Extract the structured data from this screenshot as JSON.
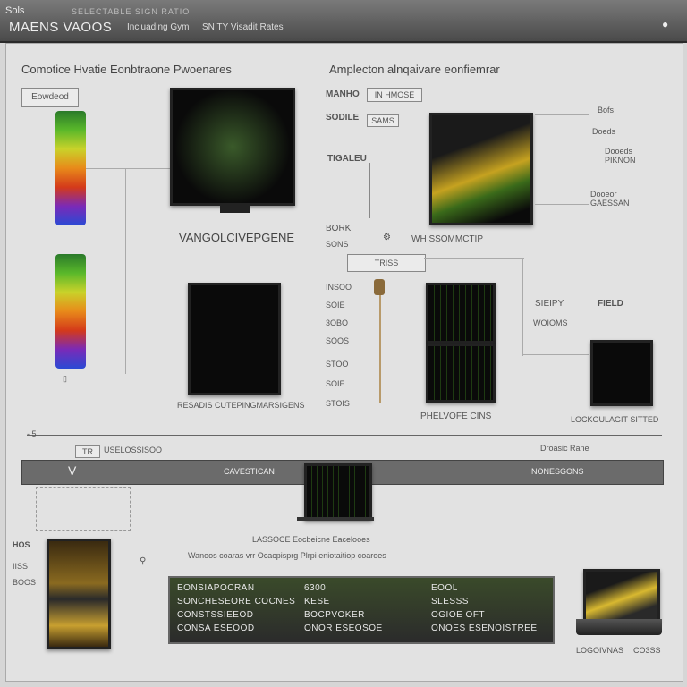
{
  "titlebar": {
    "sys_label": "Sols",
    "tiny_text": "SELECTABLE SIGN RATIO",
    "title": "MAENS VAOOS",
    "menu": [
      "Incluading Gym",
      "SN TY Visadit Rates"
    ],
    "close_label": "●"
  },
  "left_section": {
    "heading": "Comotice Hvatie Eonbtraone Pwoenares",
    "label_box": "Eowdeod",
    "monitor_caption": "VANGOLCIVEPGENE",
    "screen_caption": "RESADIS CUTEPINGMARSIGENS"
  },
  "right_section": {
    "heading": "Amplecton alnqaivare eonfiemrar",
    "labels_top": [
      "MANHO",
      "SODILE",
      "TIGALEU"
    ],
    "label_box_1": "IN HMOSE",
    "label_box_2": "SAMS",
    "right_labels": [
      "Bofs",
      "Doeds",
      "Dooeds PIKNON",
      "Dooeor GAESSAN"
    ],
    "stat_labels": [
      "BORK",
      "SONS"
    ],
    "service_caption": "WH SSOMMCTIP",
    "filter_box": "TRISS",
    "column_labels": [
      "INSOO",
      "SOIE",
      "3OBO",
      "SOOS",
      "STOO",
      "SOIE",
      "STOIS"
    ],
    "mid_caption": "PHELVOFE CINS",
    "right_side_labels": [
      "SIEIPY",
      "WOIOMS",
      "FIELD"
    ],
    "bottom_right_caption": "LOCKOULAGIT SITTED"
  },
  "timeline": {
    "left_marker": "- 5",
    "left_box": "TR",
    "left_text": "USELOSSISOO",
    "right_text": "Droasic Rane"
  },
  "grey_bar": {
    "left_label": "V",
    "center_label": "CAVESTICAN",
    "right_label": "NONESGONS"
  },
  "bottom": {
    "caption_1": "LASSOCE Eocbeicne Eacelooes",
    "caption_2": "Wanoos coaras  vrr  Ocacpisprg  Plrpi   eniotaitiop  coaroes",
    "left_icon_labels": [
      "HOS",
      "IISS",
      "BOOS"
    ],
    "laptop_caption_left": "LOGOIVNAS",
    "laptop_caption_right": "CO3SS"
  },
  "table": {
    "rows": [
      [
        "EONSIAPOCRAN",
        "6300",
        "EOOL"
      ],
      [
        "SONCHESEORE COCNES",
        "KESE",
        "SLESSS"
      ],
      [
        "CONSTSSIEEOD",
        "BOCPVOKER",
        "OGIOE OFT"
      ],
      [
        "CONSA ESEOOD",
        "ONOR ESEOSOE",
        "ONOES ESENOISTREE"
      ]
    ]
  },
  "colors": {
    "titlebar": "#4a4a4a",
    "panel": "#e2e2e2",
    "accent_green": "#5ab82a",
    "table_bg": "#2b2b2b",
    "graybar": "#6b6b6b"
  }
}
